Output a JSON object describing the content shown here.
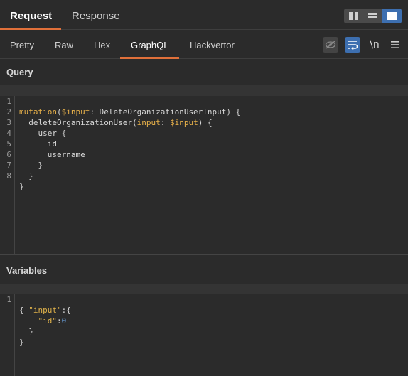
{
  "tabs": {
    "request": "Request",
    "response": "Response"
  },
  "view_tabs": [
    "Pretty",
    "Raw",
    "Hex",
    "GraphQL",
    "Hackvertor"
  ],
  "toolbar": {
    "newline_label": "\\n"
  },
  "sections": {
    "query": "Query",
    "variables": "Variables"
  },
  "query_lines": [
    {
      "n": "1"
    },
    {
      "n": "2"
    },
    {
      "n": "3"
    },
    {
      "n": "4"
    },
    {
      "n": "5"
    },
    {
      "n": "6"
    },
    {
      "n": "7"
    },
    {
      "n": "8"
    }
  ],
  "query_text": {
    "l1_kw": "mutation",
    "l1_var": "$input",
    "l1_type": "DeleteOrganizationUserInput",
    "l2_field": "deleteOrganizationUser",
    "l2_arg": "input",
    "l2_var": "$input",
    "l3": "user {",
    "l4": "id",
    "l5": "username",
    "l6": "}",
    "l7": "}",
    "l8": "}"
  },
  "variables_lines": [
    {
      "n": "1"
    }
  ],
  "variables_text": {
    "l1": "{",
    "key_input": "\"input\"",
    "key_id": "\"id\"",
    "id_value": "0",
    "l4": "}",
    "l5": "}"
  },
  "colors": {
    "accent": "#e0703a",
    "active_button": "#3d6fb0"
  }
}
